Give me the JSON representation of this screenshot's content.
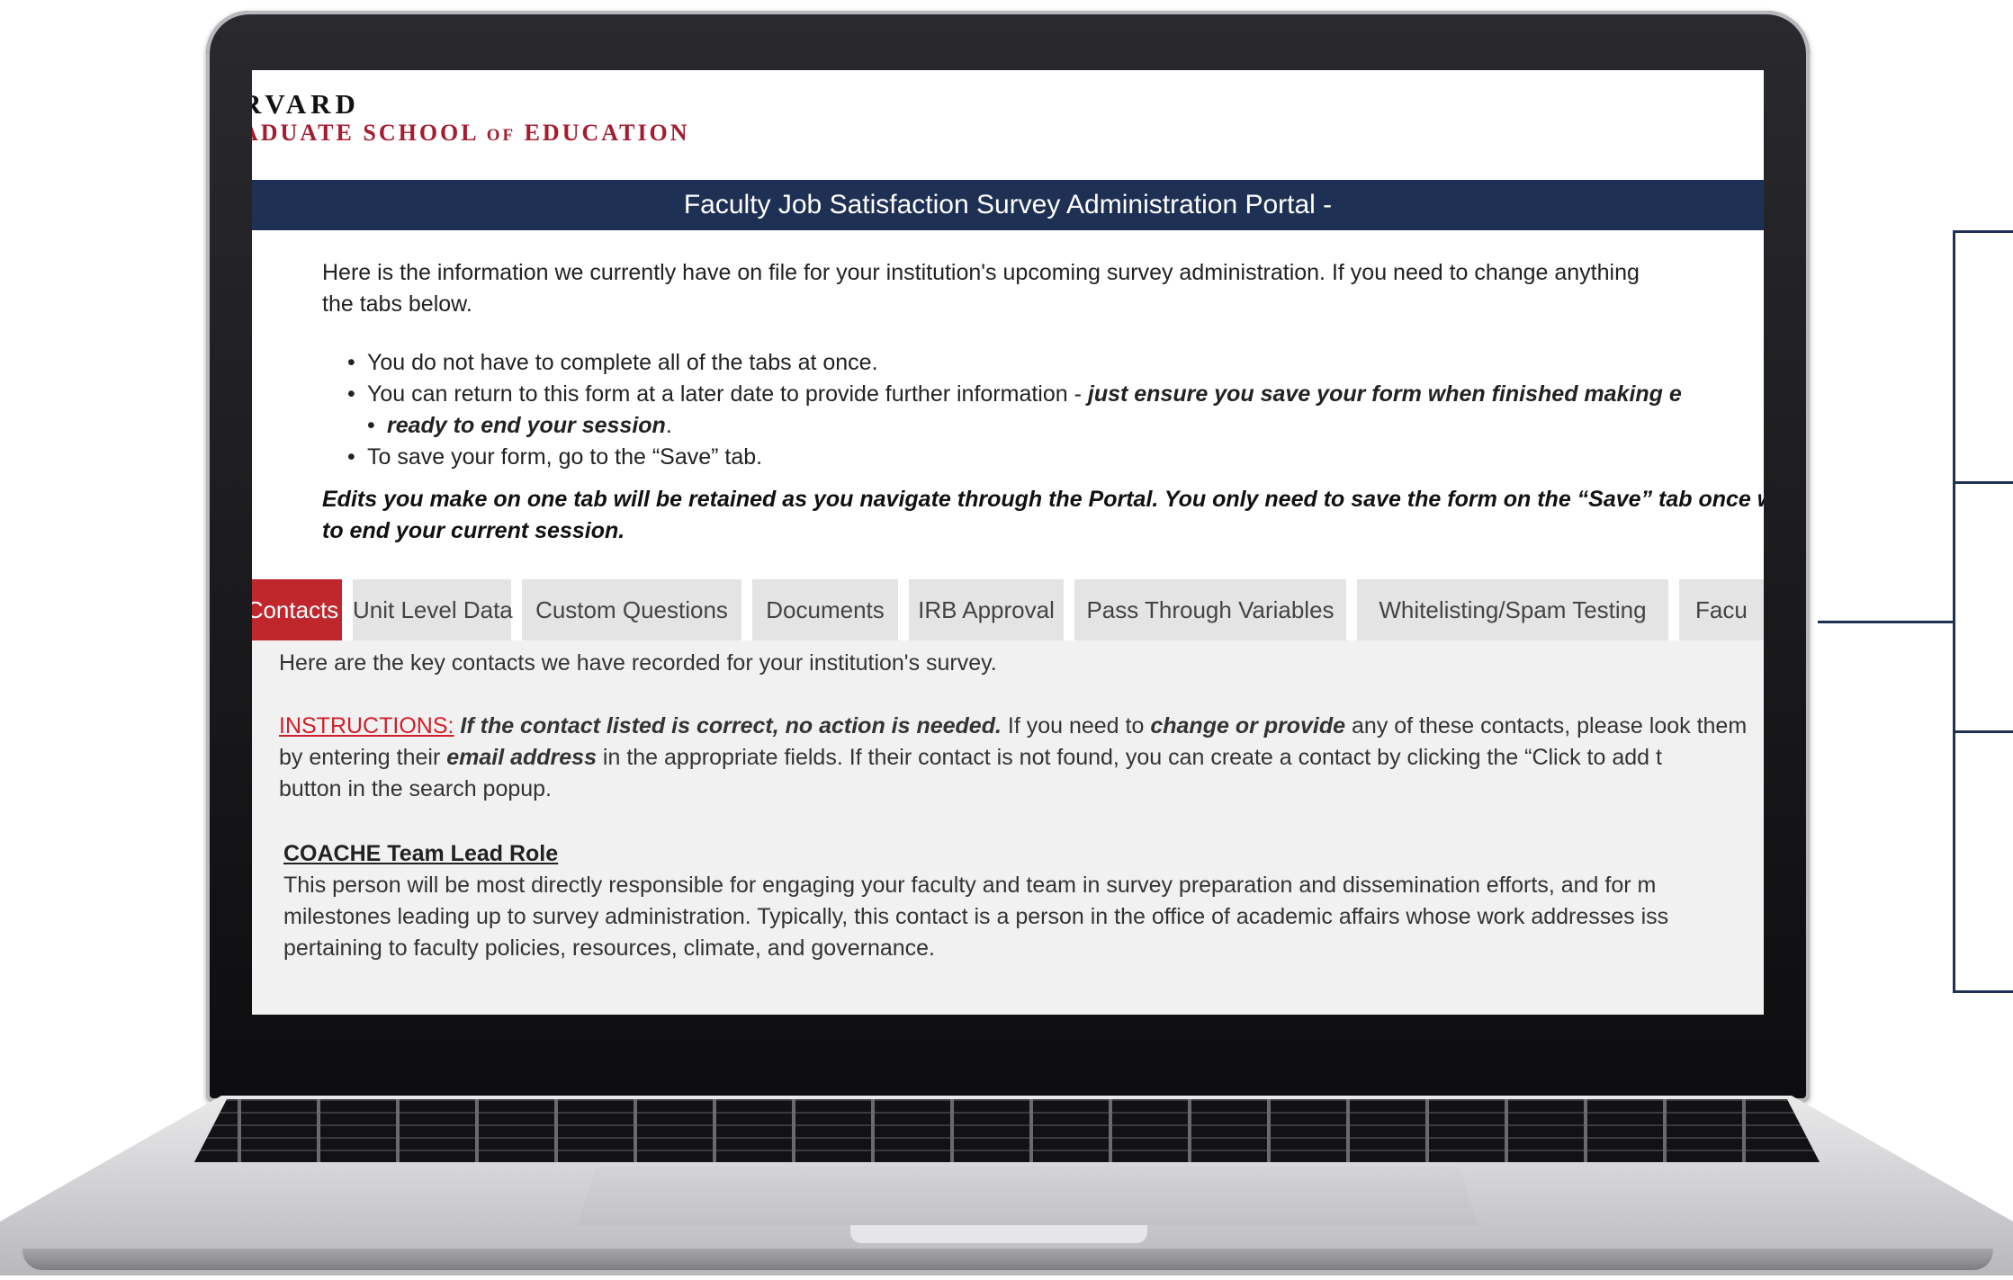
{
  "logo": {
    "line1": "RVARD",
    "line2_a": "ADUATE SCHOOL ",
    "line2_of": "OF",
    "line2_b": " EDUCATION"
  },
  "header": {
    "title": "Faculty Job Satisfaction Survey Administration Portal -"
  },
  "intro": {
    "line1": "Here is the information we currently have on file for your institution's upcoming survey administration.  If you need to change anything",
    "line2": "the tabs below."
  },
  "bullets": {
    "b1": "You do not have to complete all of the tabs at once.",
    "b2_plain": "You can return to this form at a later date to provide further information - ",
    "b2_emph": "just ensure you save your form when finished making e",
    "b2_cont_emph": "ready to end your session",
    "b2_cont_end": ".",
    "b3": "To save your form, go to the “Save” tab."
  },
  "edits": {
    "line1": "Edits you make on one tab will be retained as you navigate through the Portal. You only need to save the form on the “Save” tab once w",
    "line2": "to end your current session."
  },
  "tabs": [
    {
      "label": "Contacts",
      "active": true
    },
    {
      "label": "Unit Level Data"
    },
    {
      "label": "Custom Questions"
    },
    {
      "label": "Documents"
    },
    {
      "label": "IRB Approval"
    },
    {
      "label": "Pass Through Variables"
    },
    {
      "label": "Whitelisting/Spam Testing"
    },
    {
      "label": "Facu"
    }
  ],
  "contacts": {
    "intro": "Here are the key contacts we have recorded for your institution's survey.",
    "instr_label": "INSTRUCTIONS:",
    "instr_emph1": " If the contact listed is correct, no action is needed.",
    "instr_plain1": " If you need to ",
    "instr_emph2": "change or provide",
    "instr_plain2": " any of these contacts, please look them",
    "instr_line2_a": "by entering their ",
    "instr_line2_emph": "email address",
    "instr_line2_b": " in the appropriate fields.  If their contact is not found, you can create a contact by clicking the “Click to add t",
    "instr_line3": "button in the search popup.",
    "lead_heading": "COACHE Team Lead Role",
    "lead_line1": "This person will be most directly responsible for engaging your faculty and team in survey preparation and dissemination efforts, and for m",
    "lead_line2": "milestones leading up to survey administration. Typically, this contact is a person in the office of academic affairs whose work addresses iss",
    "lead_line3": "pertaining to faculty policies, resources, climate, and governance."
  },
  "colors": {
    "navy": "#1e3155",
    "crimson": "#a51c30",
    "tab_active": "#c0272d"
  }
}
